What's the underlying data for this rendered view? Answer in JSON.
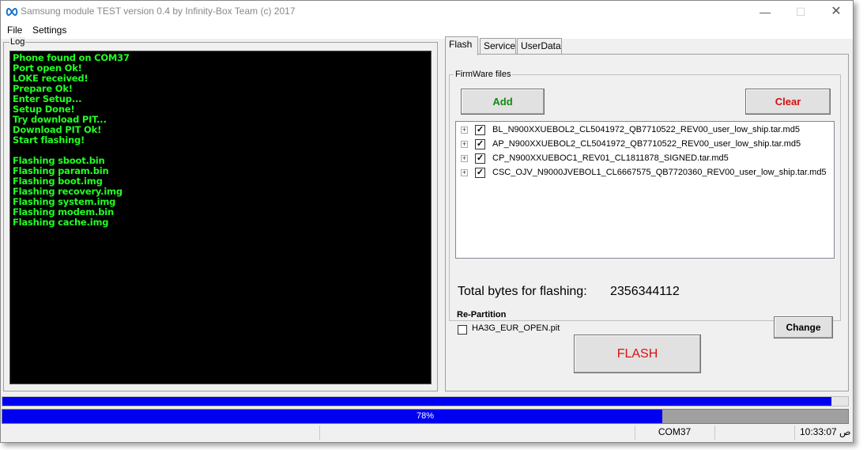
{
  "window": {
    "title": "Samsung module TEST version 0.4 by Infinity-Box Team (c) 2017",
    "minimize_glyph": "—",
    "maximize_glyph": "☐",
    "close_glyph": "✕"
  },
  "menu": {
    "file": "File",
    "settings": "Settings"
  },
  "log": {
    "label": "Log",
    "lines": [
      "Phone found on COM37",
      "Port open Ok!",
      "LOKE received!",
      "Prepare Ok!",
      "Enter Setup...",
      "Setup Done!",
      "Try download PIT...",
      "Download PIT Ok!",
      "Start flashing!",
      "",
      "Flashing sboot.bin",
      "Flashing param.bin",
      "Flashing boot.img",
      "Flashing recovery.img",
      "Flashing system.img",
      "Flashing modem.bin",
      "Flashing cache.img"
    ]
  },
  "tabs": {
    "flash": "Flash",
    "service": "Service",
    "userdata": "UserData"
  },
  "firmware": {
    "group_label": "FirmWare files",
    "add_label": "Add",
    "clear_label": "Clear",
    "files": [
      {
        "checked": true,
        "name": "BL_N900XXUEBOL2_CL5041972_QB7710522_REV00_user_low_ship.tar.md5"
      },
      {
        "checked": true,
        "name": "AP_N900XXUEBOL2_CL5041972_QB7710522_REV00_user_low_ship.tar.md5"
      },
      {
        "checked": true,
        "name": "CP_N900XXUEBOC1_REV01_CL1811878_SIGNED.tar.md5"
      },
      {
        "checked": true,
        "name": "CSC_OJV_N9000JVEBOL1_CL6667575_QB7720360_REV00_user_low_ship.tar.md5"
      }
    ],
    "expand_glyph": "+",
    "check_glyph": "✓"
  },
  "total": {
    "label": "Total bytes for flashing:",
    "value": "2356344112"
  },
  "repartition": {
    "label": "Re-Partition",
    "pit_file": "HA3G_EUR_OPEN.pit",
    "pit_checked": false,
    "change_label": "Change"
  },
  "flash_button": "FLASH",
  "progress": {
    "top_fraction": 0.98,
    "main_fraction": 0.78,
    "main_text": "78%"
  },
  "status": {
    "port": "COM37",
    "time": "10:33:07 ص"
  }
}
